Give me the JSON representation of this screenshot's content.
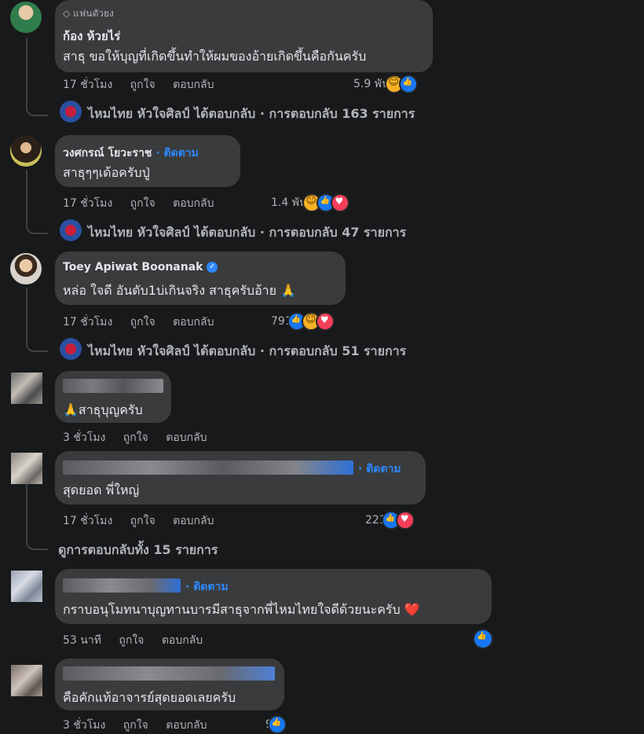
{
  "comments": [
    {
      "badge": "แฟนตัวยง",
      "name": "ก้อง ห้วยไร่",
      "text": "สาธุ ขอให้บุญที่เกิดขึ้นทำให้ผมของอ้ายเกิดขึ้นคือกันครับ",
      "time": "17 ชั่วโมง",
      "like": "ถูกใจ",
      "reply": "ตอบกลับ",
      "reaction_count": "5.9 พัน",
      "replies_line": "ไหมไทย หัวใจศิลป์ ได้ตอบกลับ · การตอบกลับ 163 รายการ"
    },
    {
      "name": "วงศกรณ์ โยวะราช",
      "follow": "ติดตาม",
      "text": "สาธุๆๆเด้อครับปู่",
      "time": "17 ชั่วโมง",
      "like": "ถูกใจ",
      "reply": "ตอบกลับ",
      "reaction_count": "1.4 พัน",
      "replies_line": "ไหมไทย หัวใจศิลป์ ได้ตอบกลับ · การตอบกลับ 47 รายการ"
    },
    {
      "name": "Toey Apiwat Boonanak",
      "text": "หล่อ ใจดี อันดับ1บ่เกินจริง สาธุครับอ้าย 🙏",
      "time": "17 ชั่วโมง",
      "like": "ถูกใจ",
      "reply": "ตอบกลับ",
      "reaction_count": "791",
      "replies_line": "ไหมไทย หัวใจศิลป์ ได้ตอบกลับ · การตอบกลับ 51 รายการ"
    },
    {
      "text": "🙏สาธุบุญครับ",
      "time": "3 ชั่วโมง",
      "like": "ถูกใจ",
      "reply": "ตอบกลับ"
    },
    {
      "follow": "· ติดตาม",
      "text": "สุดยอด พี่ใหญ่",
      "time": "17 ชั่วโมง",
      "like": "ถูกใจ",
      "reply": "ตอบกลับ",
      "reaction_count": "221",
      "view_replies": "ดูการตอบกลับทั้ง 15 รายการ"
    },
    {
      "follow": "· ติดตาม",
      "text": "กราบอนุโมทนาบุญทานบารมีสาธุจากพี่ไหมไทยใจดีด้วยนะครับ ❤️",
      "time": "53 นาที",
      "like": "ถูกใจ",
      "reply": "ตอบกลับ"
    },
    {
      "text": "คือคักแท้อาจารย์สุดยอดเลยครับ",
      "time": "3 ชั่วโมง",
      "like": "ถูกใจ",
      "reply": "ตอบกลับ",
      "reaction_count": "9"
    }
  ],
  "colors": {
    "background": "#18191a",
    "bubble": "#3a3b3c",
    "link": "#2d88ff",
    "like": "#1877f2",
    "love": "#f33e58",
    "haha": "#f7b125"
  }
}
